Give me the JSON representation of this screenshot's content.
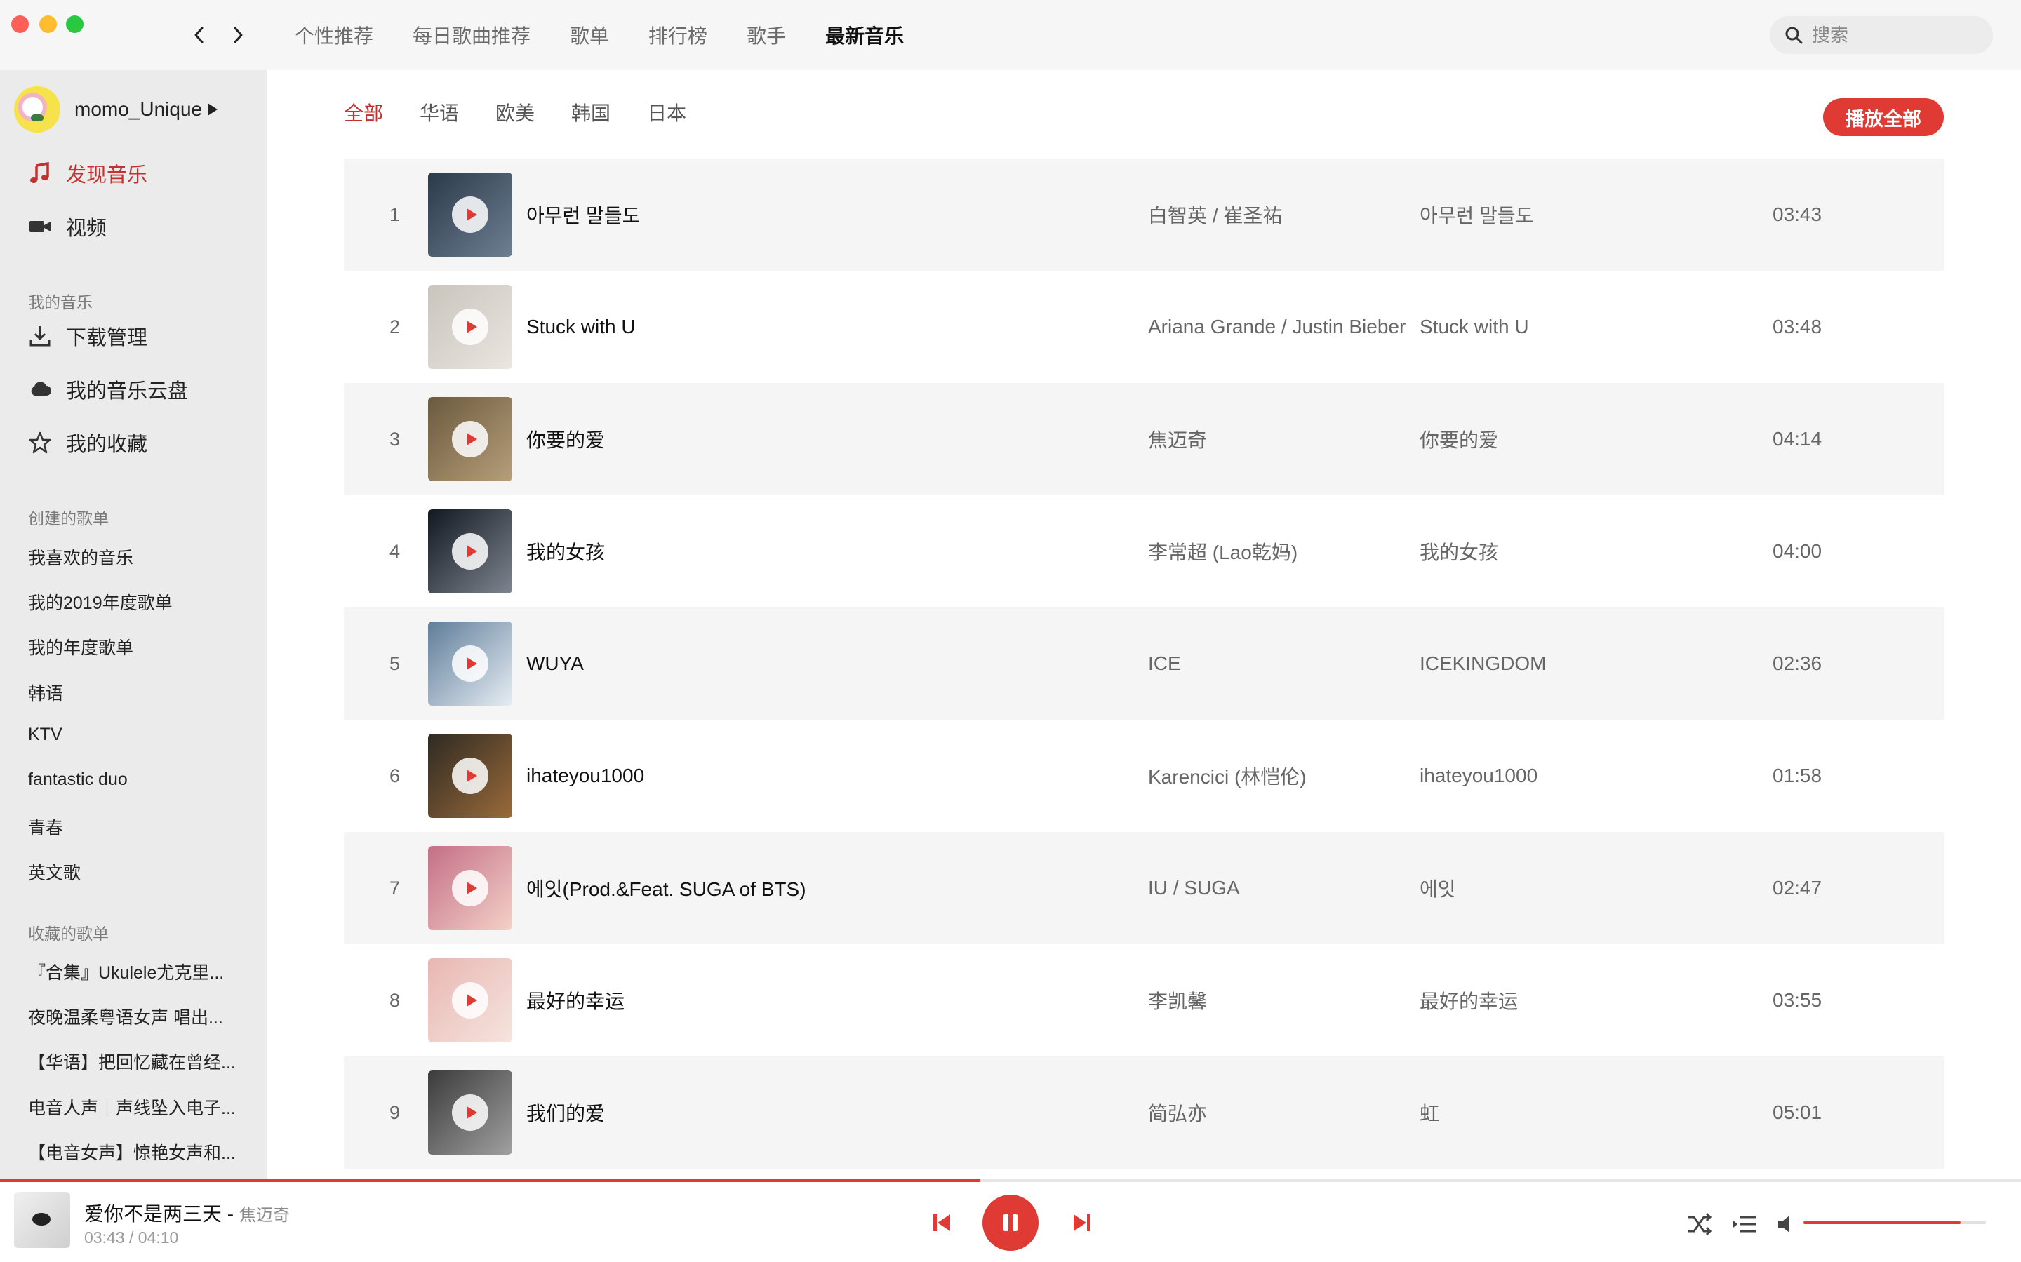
{
  "top_nav": {
    "tabs": [
      {
        "label": "个性推荐"
      },
      {
        "label": "每日歌曲推荐"
      },
      {
        "label": "歌单"
      },
      {
        "label": "排行榜"
      },
      {
        "label": "歌手"
      },
      {
        "label": "最新音乐",
        "active": true
      }
    ]
  },
  "search": {
    "placeholder": "搜索"
  },
  "sidebar": {
    "username": "momo_Unique",
    "main_items": [
      {
        "label": "发现音乐",
        "icon": "music-note-icon",
        "active": true
      },
      {
        "label": "视频",
        "icon": "video-camera-icon"
      }
    ],
    "my_music_title": "我的音乐",
    "my_music_items": [
      {
        "label": "下载管理",
        "icon": "download-icon"
      },
      {
        "label": "我的音乐云盘",
        "icon": "cloud-icon"
      },
      {
        "label": "我的收藏",
        "icon": "star-icon"
      }
    ],
    "created_title": "创建的歌单",
    "created_playlists": [
      "我喜欢的音乐",
      "我的2019年度歌单",
      "我的年度歌单",
      "韩语",
      "KTV",
      "fantastic duo",
      "青春",
      "英文歌"
    ],
    "collected_title": "收藏的歌单",
    "collected_playlists": [
      "『合集』Ukulele尤克里...",
      "夜晚温柔粤语女声 唱出...",
      "【华语】把回忆藏在曾经...",
      "电音人声｜声线坠入电子...",
      "【电音女声】惊艳女声和..."
    ]
  },
  "filters": [
    {
      "label": "全部",
      "active": true
    },
    {
      "label": "华语"
    },
    {
      "label": "欧美"
    },
    {
      "label": "韩国"
    },
    {
      "label": "日本"
    }
  ],
  "play_all_label": "播放全部",
  "songs": [
    {
      "index": "1",
      "title": "아무런 말들도",
      "artist": "白智英 / 崔圣祐",
      "album": "아무런 말들도",
      "duration": "03:43",
      "cover": [
        "#2b3a4a",
        "#6d7f92"
      ]
    },
    {
      "index": "2",
      "title": "Stuck with U",
      "artist": "Ariana Grande / Justin Bieber",
      "album": "Stuck with U",
      "duration": "03:48",
      "cover": [
        "#c9c4bc",
        "#eae6e0"
      ]
    },
    {
      "index": "3",
      "title": "你要的爱",
      "artist": "焦迈奇",
      "album": "你要的爱",
      "duration": "04:14",
      "cover": [
        "#6b5a3e",
        "#b69e7a"
      ]
    },
    {
      "index": "4",
      "title": "我的女孩",
      "artist": "李常超 (Lao乾妈)",
      "album": "我的女孩",
      "duration": "04:00",
      "cover": [
        "#121820",
        "#7e8590"
      ]
    },
    {
      "index": "5",
      "title": "WUYA",
      "artist": "ICE",
      "album": "ICEKINGDOM",
      "duration": "02:36",
      "cover": [
        "#5f7d9a",
        "#e6edf3"
      ]
    },
    {
      "index": "6",
      "title": "ihateyou1000",
      "artist": "Karencici (林恺伦)",
      "album": "ihateyou1000",
      "duration": "01:58",
      "cover": [
        "#2e2a22",
        "#9a6a3a"
      ]
    },
    {
      "index": "7",
      "title": "에잇(Prod.&Feat. SUGA of BTS)",
      "artist": "IU / SUGA",
      "album": "에잇",
      "duration": "02:47",
      "cover": [
        "#c46f86",
        "#f3d1c8"
      ]
    },
    {
      "index": "8",
      "title": "最好的幸运",
      "artist": "李凯馨",
      "album": "最好的幸运",
      "duration": "03:55",
      "cover": [
        "#e8b7b2",
        "#f6e4de"
      ]
    },
    {
      "index": "9",
      "title": "我们的爱",
      "artist": "简弘亦",
      "album": "虹",
      "duration": "05:01",
      "cover": [
        "#3b3b3b",
        "#a0a0a0"
      ]
    }
  ],
  "player": {
    "title": "爱你不是两三天 - ",
    "artist": "焦迈奇",
    "time": "03:43 / 04:10",
    "progress": 0.485,
    "volume": 0.86,
    "accent": "#e03a35"
  }
}
